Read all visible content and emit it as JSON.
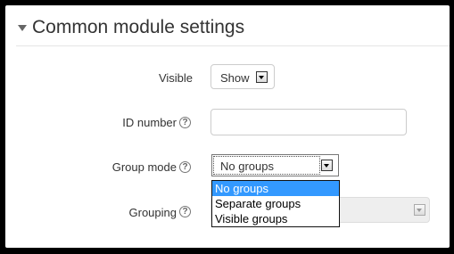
{
  "section": {
    "title": "Common module settings"
  },
  "fields": {
    "visible": {
      "label": "Visible",
      "value": "Show"
    },
    "id_number": {
      "label": "ID number",
      "value": ""
    },
    "group_mode": {
      "label": "Group mode",
      "value": "No groups",
      "options": [
        "No groups",
        "Separate groups",
        "Visible groups"
      ],
      "selected_index": 0
    },
    "grouping": {
      "label": "Grouping",
      "value": ""
    }
  },
  "help_icon_glyph": "?",
  "colors": {
    "highlight": "#3399ff",
    "frame": "#000000"
  }
}
